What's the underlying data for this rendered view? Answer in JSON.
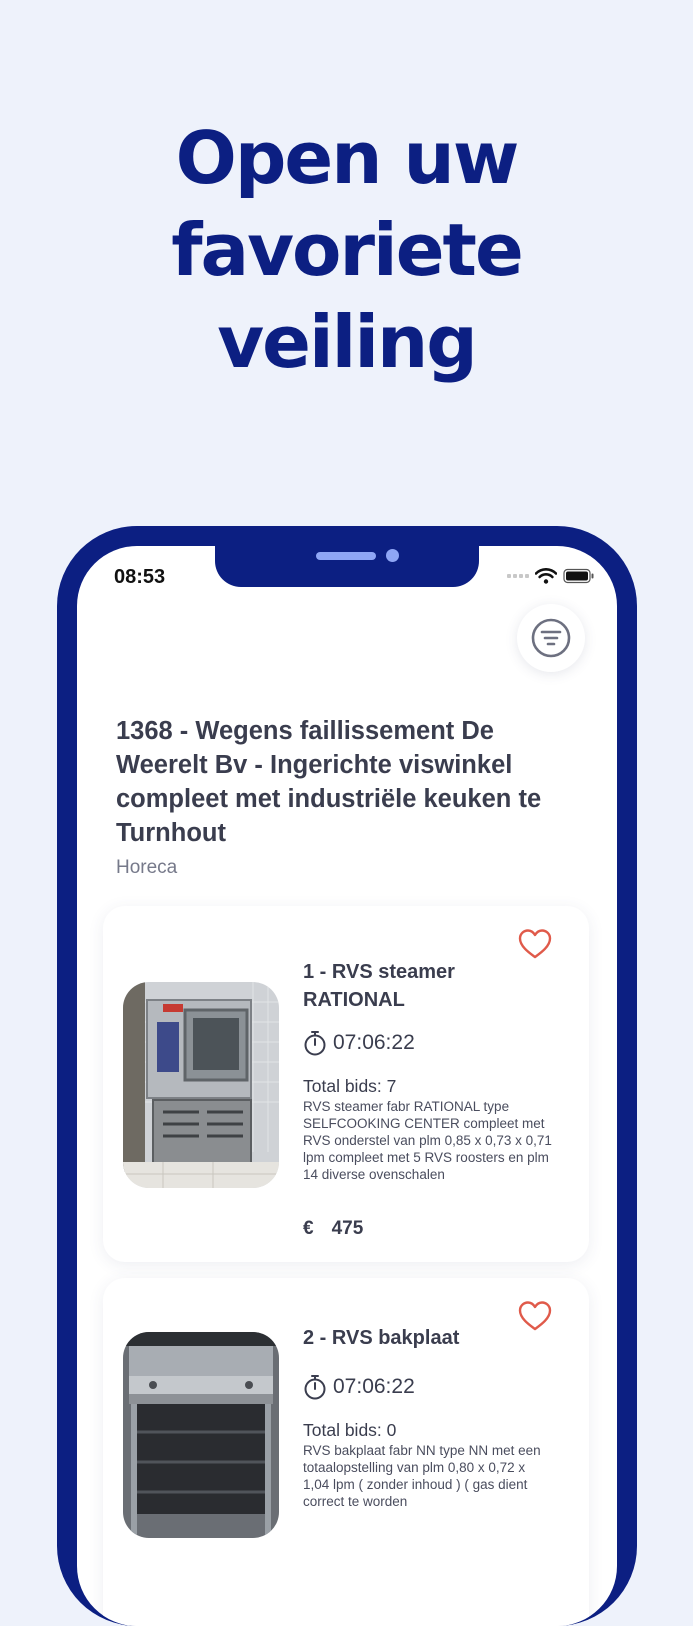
{
  "headline": {
    "line1": "Open uw favoriete",
    "line2": "veiling"
  },
  "status_bar": {
    "time": "08:53"
  },
  "auction": {
    "title": "1368 - Wegens faillissement De Weerelt Bv - Ingerichte viswinkel compleet met industriële keuken te Turnhout",
    "category": "Horeca"
  },
  "lots": [
    {
      "title": "1 - RVS steamer RATIONAL",
      "timer": "07:06:22",
      "bids": "Total bids: 7",
      "description": "RVS steamer fabr RATIONAL type SELFCOOKING CENTER compleet met RVS onderstel van plm 0,85 x 0,73 x 0,71 lpm compleet met 5 RVS roosters en plm 14 diverse ovenschalen",
      "currency": "€",
      "price": "475"
    },
    {
      "title": "2 - RVS bakplaat",
      "timer": "07:06:22",
      "bids": "Total bids: 0",
      "description": "RVS bakplaat fabr NN type NN met een totaalopstelling van plm 0,80 x 0,72 x 1,04 lpm ( zonder inhoud ) ( gas dient correct te worden"
    }
  ],
  "icons": {
    "filter": "filter-icon",
    "favorite": "heart-outline-icon",
    "timer": "stopwatch-icon",
    "wifi": "wifi-icon",
    "battery": "battery-icon"
  },
  "colors": {
    "brand": "#0c1f82",
    "background": "#eef2fb",
    "heart": "#e05a4a",
    "notch_accent": "#8fa6f5"
  }
}
